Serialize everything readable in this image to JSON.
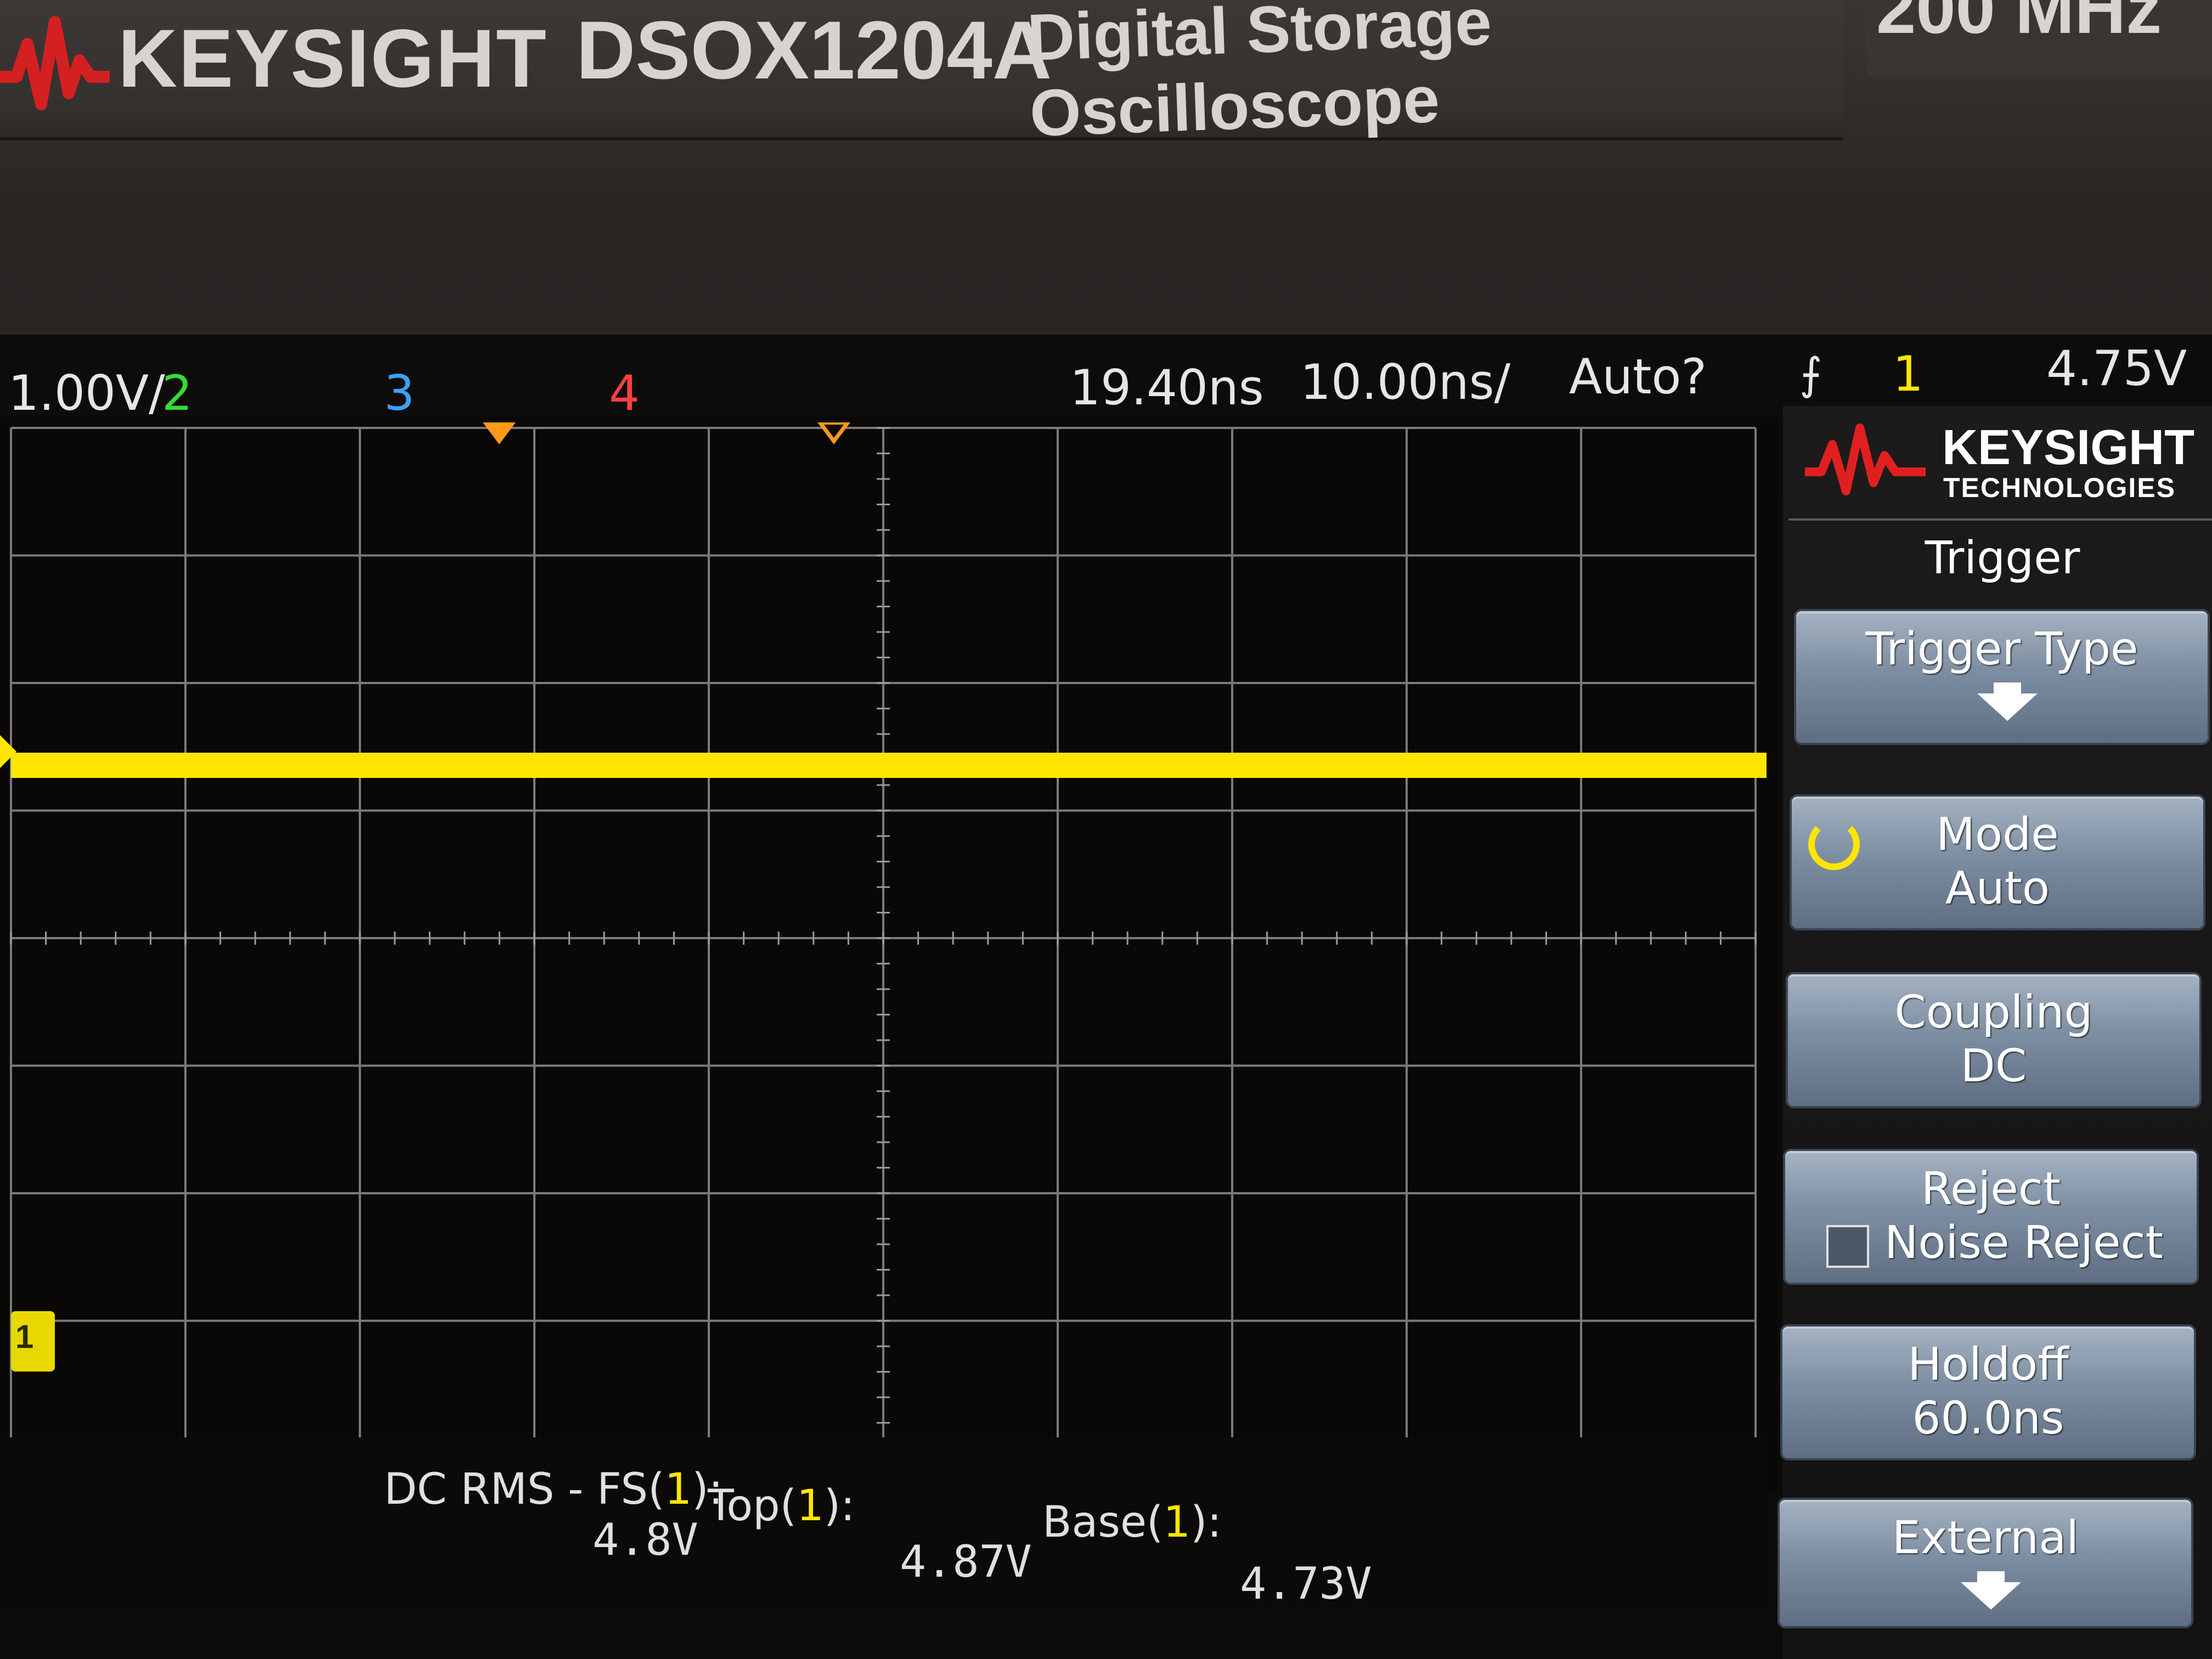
{
  "brand": {
    "name": "KEYSIGHT",
    "model": "DSOX1204A",
    "description": "Digital Storage Oscilloscope",
    "bandwidth": "200 MHz"
  },
  "status_bar": {
    "ch1_scale": "1.00V/",
    "ch2_label": "2",
    "ch3_label": "3",
    "ch4_label": "4",
    "delay": "19.40ns",
    "timebase": "10.00ns/",
    "trigger_state": "Auto?",
    "trigger_source": "1",
    "trigger_level": "4.75V"
  },
  "waveform": {
    "channel": "1",
    "color": "#ffe600"
  },
  "measurements": [
    {
      "label_prefix": "DC RMS - FS(",
      "channel": "1",
      "label_suffix": "):",
      "value": "4.8V"
    },
    {
      "label_prefix": "Top(",
      "channel": "1",
      "label_suffix": "):",
      "value": "4.87V"
    },
    {
      "label_prefix": "Base(",
      "channel": "1",
      "label_suffix": "):",
      "value": "4.73V"
    }
  ],
  "softkey_panel": {
    "logo_name": "KEYSIGHT",
    "logo_sub": "TECHNOLOGIES",
    "menu_title": "Trigger",
    "keys": [
      {
        "line1": "Trigger Type",
        "line2": ""
      },
      {
        "line1": "Mode",
        "line2": "Auto"
      },
      {
        "line1": "Coupling",
        "line2": "DC"
      },
      {
        "line1": "Reject",
        "line2": "Noise Reject"
      },
      {
        "line1": "Holdoff",
        "line2": "60.0ns"
      },
      {
        "line1": "External",
        "line2": ""
      }
    ]
  },
  "ground_marker": "1",
  "colors": {
    "ch1": "#ffe600",
    "ch2": "#33dd33",
    "ch3": "#3aa0ff",
    "ch4": "#ff4040",
    "trigger_marker": "#ff9a1a",
    "softkey": "#7e8ea2"
  }
}
